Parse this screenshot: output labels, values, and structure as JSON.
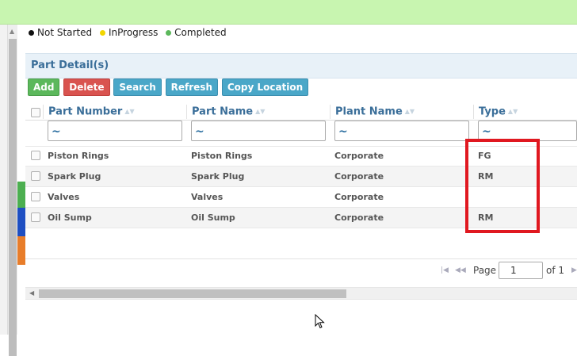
{
  "legend": {
    "items": [
      {
        "label": "Not Started",
        "color": "#111111"
      },
      {
        "label": "InProgress",
        "color": "#f2d600"
      },
      {
        "label": "Completed",
        "color": "#5cb85c"
      }
    ]
  },
  "panel": {
    "title": "Part Detail(s)"
  },
  "toolbar": {
    "add": "Add",
    "delete": "Delete",
    "search": "Search",
    "refresh": "Refresh",
    "copy_location": "Copy Location"
  },
  "grid": {
    "columns": [
      "Part Number",
      "Part Name",
      "Plant Name",
      "Type"
    ],
    "filters": [
      "~",
      "~",
      "~",
      "~"
    ],
    "rows": [
      {
        "part_number": "Piston Rings",
        "part_name": "Piston Rings",
        "plant_name": "Corporate",
        "type": "FG"
      },
      {
        "part_number": "Spark Plug",
        "part_name": "Spark Plug",
        "plant_name": "Corporate",
        "type": "RM"
      },
      {
        "part_number": "Valves",
        "part_name": "Valves",
        "plant_name": "Corporate",
        "type": ""
      },
      {
        "part_number": "Oil Sump",
        "part_name": "Oil Sump",
        "plant_name": "Corporate",
        "type": "RM"
      }
    ]
  },
  "pager": {
    "page_label": "Page",
    "current_page": "1",
    "of_label": "of 1"
  },
  "status_colors": [
    "#4caf50",
    "#1e4fc2",
    "#e87d2a"
  ],
  "highlight_color": "#e01820"
}
